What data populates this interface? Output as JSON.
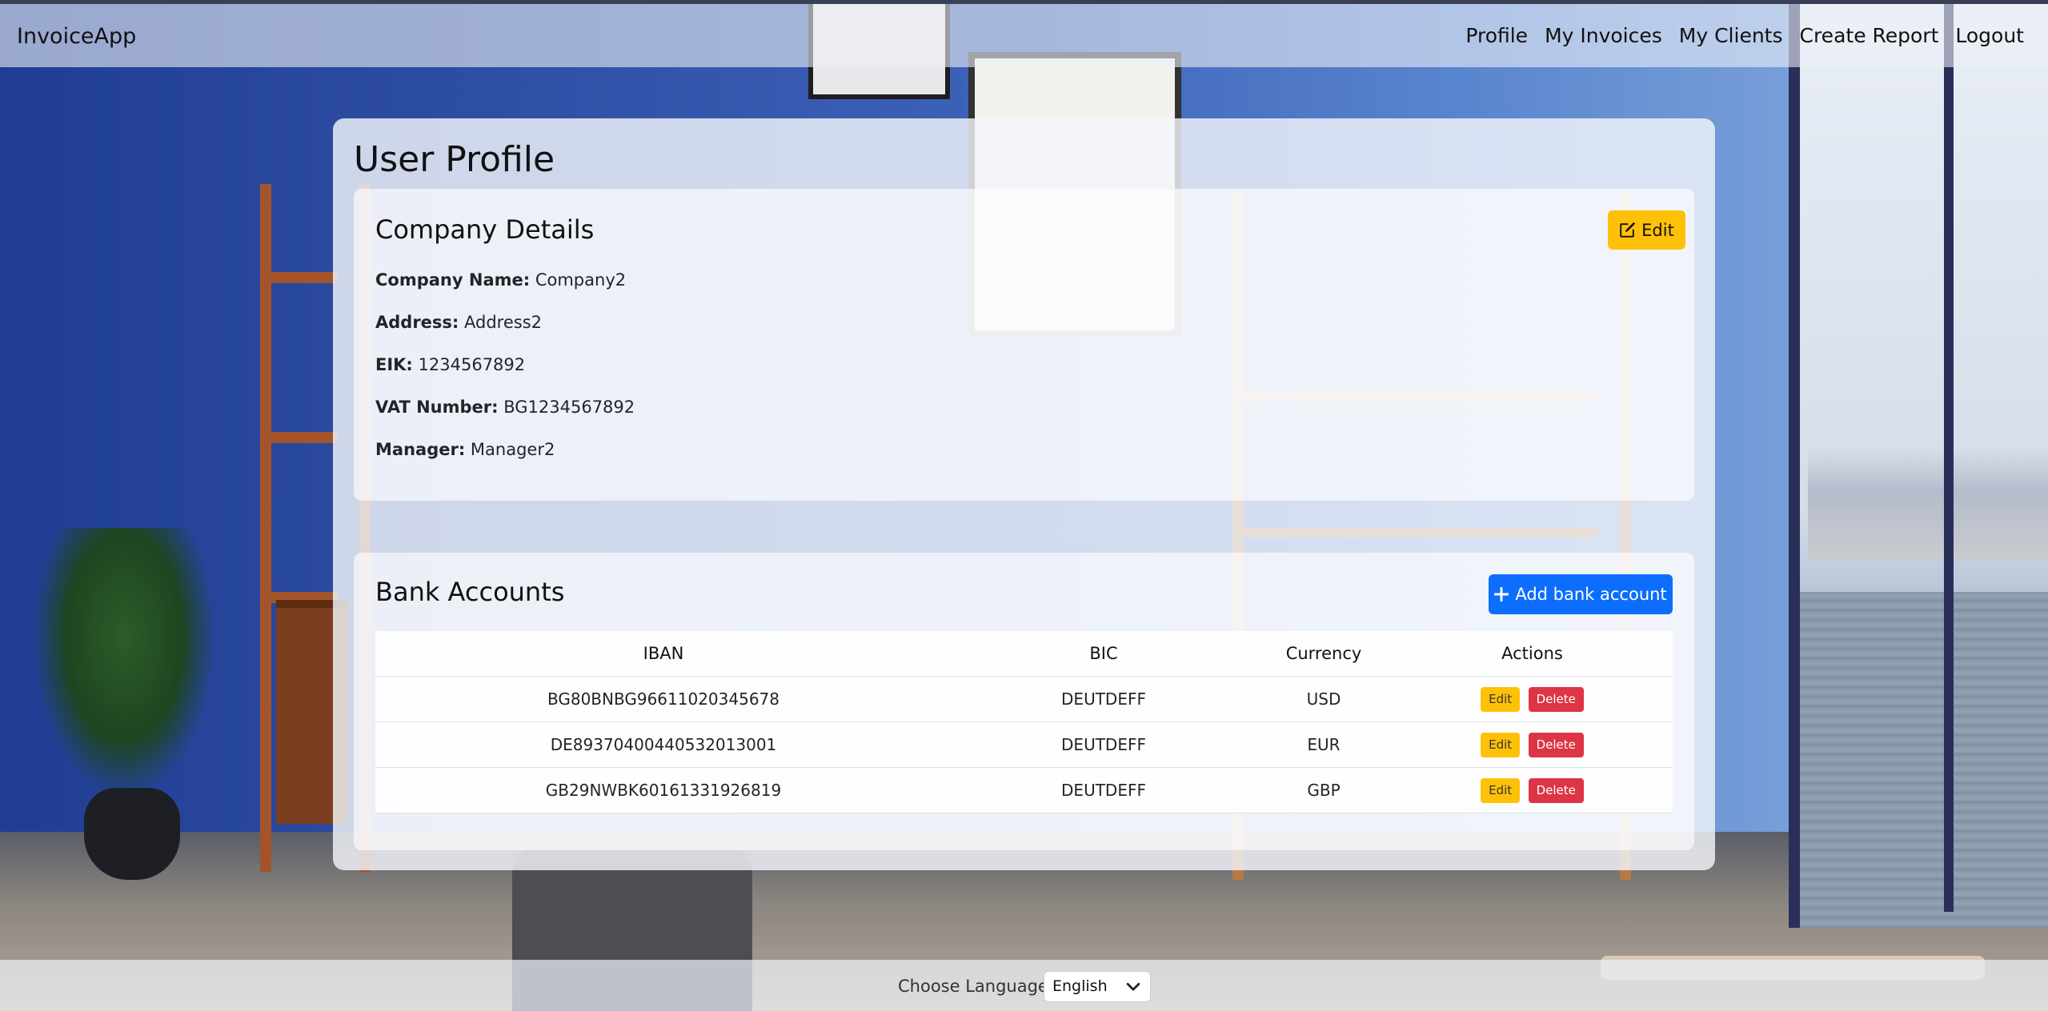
{
  "navbar": {
    "brand": "InvoiceApp",
    "links": [
      "Profile",
      "My Invoices",
      "My Clients",
      "Create Report",
      "Logout"
    ]
  },
  "page": {
    "title": "User Profile"
  },
  "company": {
    "title": "Company Details",
    "edit_label": "Edit",
    "fields": [
      {
        "label": "Company Name:",
        "value": "Company2"
      },
      {
        "label": "Address:",
        "value": "Address2"
      },
      {
        "label": "EIK:",
        "value": "1234567892"
      },
      {
        "label": "VAT Number:",
        "value": "BG1234567892"
      },
      {
        "label": "Manager:",
        "value": "Manager2"
      }
    ]
  },
  "bank": {
    "title": "Bank Accounts",
    "add_label": "Add bank account",
    "columns": [
      "IBAN",
      "BIC",
      "Currency",
      "Actions"
    ],
    "rows": [
      {
        "iban": "BG80BNBG96611020345678",
        "bic": "DEUTDEFF",
        "currency": "USD",
        "edit": "Edit",
        "delete": "Delete"
      },
      {
        "iban": "DE89370400440532013001",
        "bic": "DEUTDEFF",
        "currency": "EUR",
        "edit": "Edit",
        "delete": "Delete"
      },
      {
        "iban": "GB29NWBK60161331926819",
        "bic": "DEUTDEFF",
        "currency": "GBP",
        "edit": "Edit",
        "delete": "Delete"
      }
    ]
  },
  "footer": {
    "language_label": "Choose Language:",
    "language_value": "English"
  },
  "icons": {
    "edit": "pencil-square-icon",
    "add": "plus-icon",
    "dropdown": "chevron-down-icon"
  },
  "colors": {
    "warning": "#ffc107",
    "primary": "#0d6efd",
    "danger": "#dc3545"
  }
}
